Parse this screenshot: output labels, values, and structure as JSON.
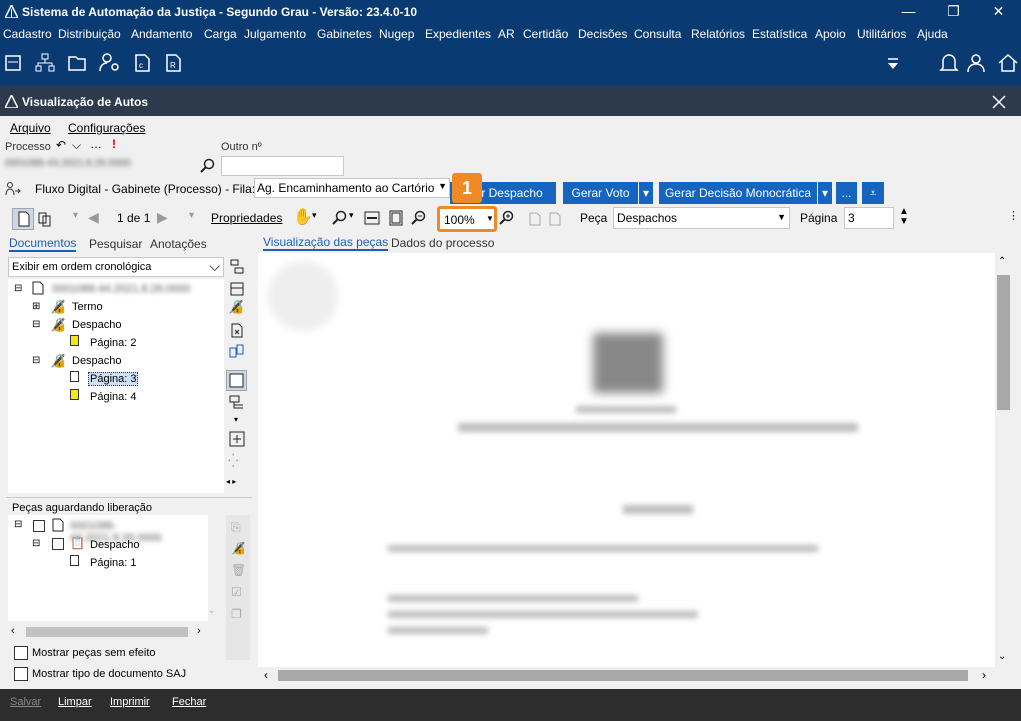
{
  "window": {
    "title": "Sistema de Automação da Justiça - Segundo Grau - Versão: 23.4.0-10",
    "minimize_icon": "minimize-icon",
    "maximize_icon": "restore-icon",
    "close_icon": "close-icon"
  },
  "menu": [
    "Cadastro",
    "Distribuição",
    "Andamento",
    "Carga",
    "Julgamento",
    "Gabinetes",
    "Nugep",
    "Expedientes",
    "AR",
    "Certidão",
    "Decisões",
    "Consulta",
    "Relatórios",
    "Estatística",
    "Apoio",
    "Utilitários",
    "Ajuda"
  ],
  "child": {
    "title": "Visualização de Autos"
  },
  "submenu": {
    "arquivo": "Arquivo",
    "configuracoes": "Configurações"
  },
  "processo": {
    "label": "Processo",
    "value_blurred": "0001086-44.2021.8.26.0000",
    "outro_label": "Outro nº",
    "outro_value": ""
  },
  "fluxo": {
    "label": "Fluxo Digital - Gabinete (Processo) - Fila:",
    "fila_value": "Ag. Encaminhamento ao Cartório",
    "btn_despacho": "r Despacho",
    "btn_voto": "Gerar Voto",
    "btn_decisao": "Gerar Decisão Monocrática",
    "btn_more": "..."
  },
  "viewer_toolbar": {
    "page_of": "1 de 1",
    "propriedades": "Propriedades",
    "zoom": "100%",
    "peca_label": "Peça",
    "peca_value": "Despachos",
    "pagina_label": "Página",
    "pagina_value": "3",
    "callout": "1"
  },
  "left_tabs": {
    "documentos": "Documentos",
    "pesquisar": "Pesquisar",
    "anotacoes": "Anotações"
  },
  "order_select": "Exibir em ordem cronológica",
  "tree": {
    "root": "0001086-44.2021.8.26.0000",
    "items": [
      "Termo",
      "Despacho",
      "Página: 2",
      "Despacho",
      "Página: 3",
      "Página: 4"
    ]
  },
  "pending": {
    "title": "Peças aguardando liberação",
    "root": "0001086-44.2021.8.26.0000",
    "item": "Despacho",
    "page": "Página: 1"
  },
  "checkboxes": {
    "sem_efeito": "Mostrar peças sem efeito",
    "tipo_saj": "Mostrar tipo de documento SAJ"
  },
  "right_tabs": {
    "pecas": "Visualização das peças",
    "dados": "Dados do processo"
  },
  "bottom": {
    "salvar": "Salvar",
    "limpar": "Limpar",
    "imprimir": "Imprimir",
    "fechar": "Fechar"
  },
  "colors": {
    "titlebar": "#0a3a72",
    "highlight": "#f08a24",
    "button": "#1565c0"
  }
}
